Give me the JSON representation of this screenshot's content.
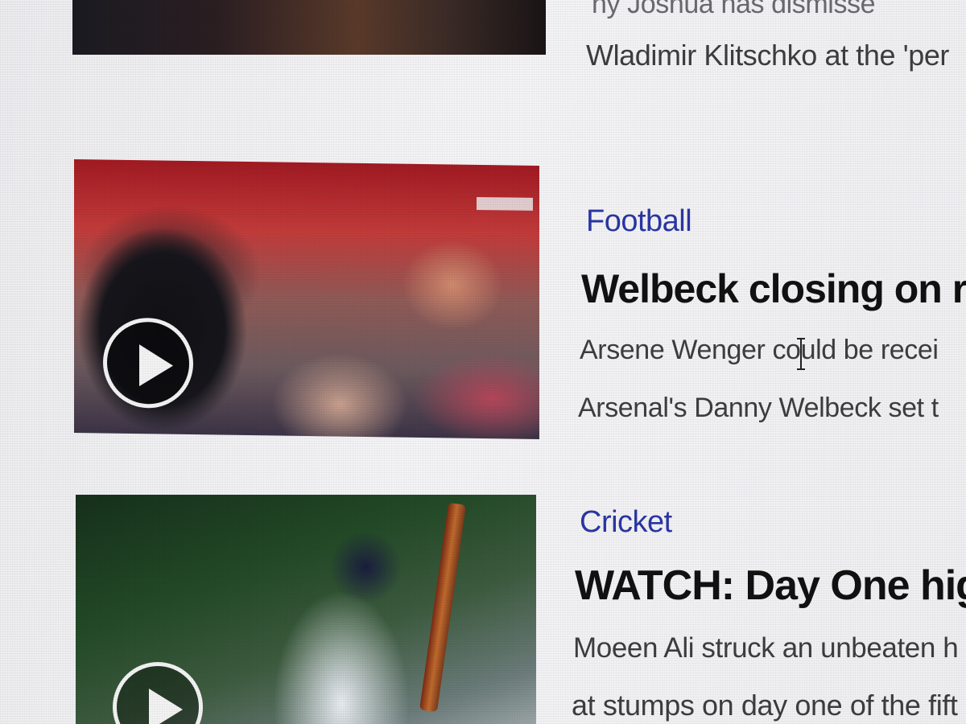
{
  "articles": [
    {
      "summary_lines": [
        "ny Joshua has dismisse",
        "Wladimir Klitschko at the 'per"
      ]
    },
    {
      "category": "Football",
      "headline": "Welbeck closing on re",
      "summary_lines": [
        "Arsene Wenger could be recei",
        "Arsenal's Danny Welbeck set t"
      ],
      "has_video": true
    },
    {
      "category": "Cricket",
      "headline": "WATCH: Day One high",
      "summary_lines": [
        "Moeen Ali struck an unbeaten h",
        "at stumps on day one of the fift"
      ],
      "has_video": true
    }
  ],
  "colors": {
    "category": "#2a36a4",
    "headline": "#111111",
    "summary": "#3d3d40"
  },
  "icons": {
    "play": "play-circle-icon",
    "cursor": "text-cursor-icon"
  }
}
